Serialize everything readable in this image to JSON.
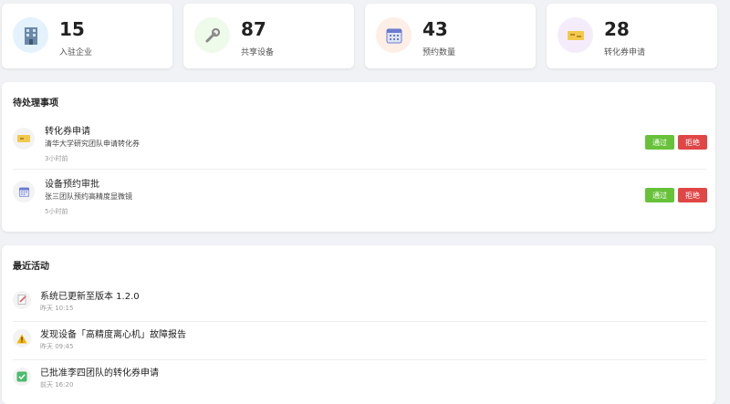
{
  "stats": [
    {
      "value": "15",
      "label": "入驻企业",
      "icon": "building-icon",
      "bg": "#e3f2fd"
    },
    {
      "value": "87",
      "label": "共享设备",
      "icon": "wrench-icon",
      "bg": "#eefaea"
    },
    {
      "value": "43",
      "label": "预约数量",
      "icon": "calendar-icon",
      "bg": "#fdeee6"
    },
    {
      "value": "28",
      "label": "转化券申请",
      "icon": "ticket-icon",
      "bg": "#f5ecfb"
    }
  ],
  "pending": {
    "title": "待处理事项",
    "items": [
      {
        "title": "转化券申请",
        "desc": "清华大学研究团队申请转化券",
        "time": "3小时前",
        "icon": "ticket-icon",
        "approve": "通过",
        "reject": "拒绝"
      },
      {
        "title": "设备预约审批",
        "desc": "张三团队预约高精度显微镜",
        "time": "5小时前",
        "icon": "calendar-icon",
        "approve": "通过",
        "reject": "拒绝"
      }
    ]
  },
  "activity": {
    "title": "最近活动",
    "items": [
      {
        "title": "系统已更新至版本 1.2.0",
        "time": "昨天 10:15",
        "icon": "document-edit-icon"
      },
      {
        "title": "发现设备「高精度离心机」故障报告",
        "time": "昨天 09:45",
        "icon": "warning-icon"
      },
      {
        "title": "已批准李四团队的转化券申请",
        "time": "前天 16:20",
        "icon": "checkmark-icon"
      }
    ]
  },
  "colors": {
    "approve": "#67c23a",
    "reject": "#e04646"
  }
}
